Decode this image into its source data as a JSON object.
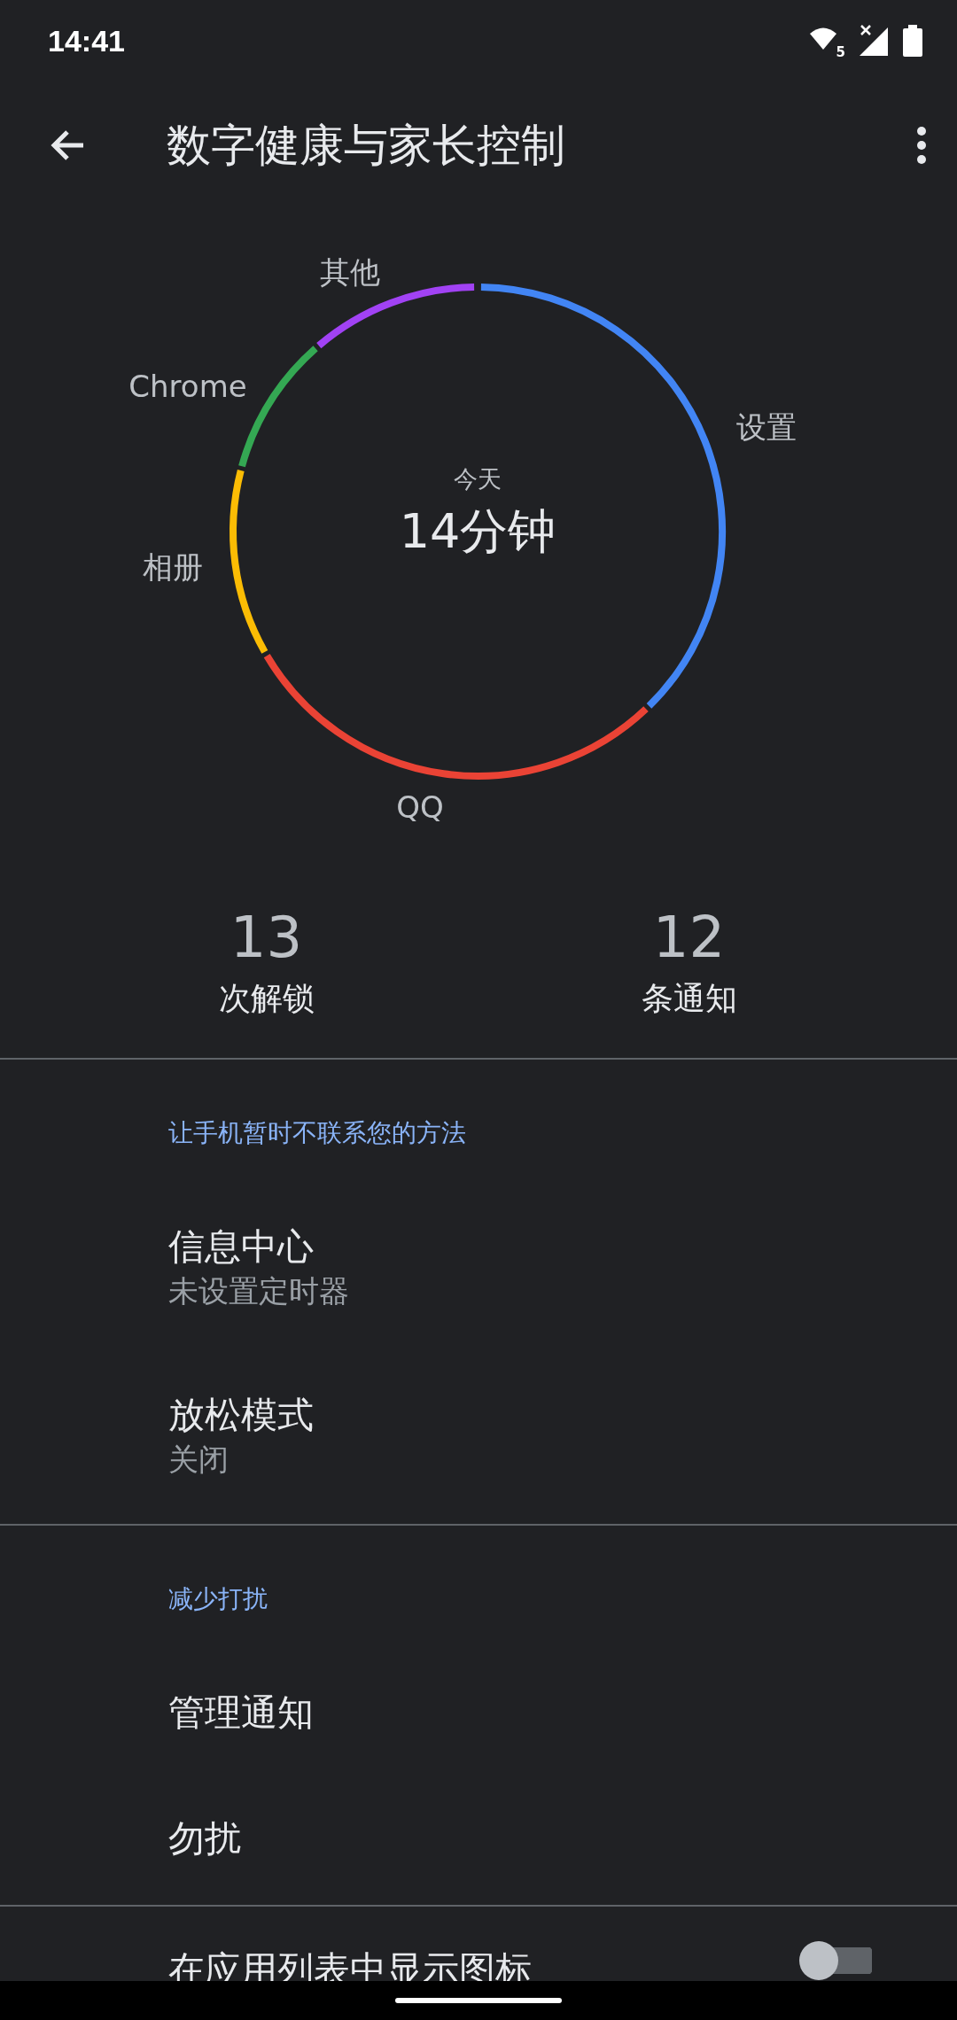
{
  "status_bar": {
    "time": "14:41",
    "wifi_badge": "5"
  },
  "app_bar": {
    "title": "数字健康与家长控制"
  },
  "usage_chart": {
    "labels": [
      {
        "text": "其他"
      },
      {
        "text": "Chrome"
      },
      {
        "text": "设置"
      },
      {
        "text": "相册"
      },
      {
        "text": "QQ"
      }
    ],
    "center_caption": "今天",
    "center_value": "14分钟"
  },
  "stats": [
    {
      "value": "13",
      "label": "次解锁"
    },
    {
      "value": "12",
      "label": "条通知"
    }
  ],
  "sections": [
    {
      "header": "让手机暂时不联系您的方法",
      "items": [
        {
          "kind": "link",
          "title": "信息中心",
          "subtitle": "未设置定时器"
        },
        {
          "kind": "link",
          "title": "放松模式",
          "subtitle": "关闭"
        }
      ]
    },
    {
      "header": "减少打扰",
      "items": [
        {
          "kind": "link",
          "title": "管理通知"
        },
        {
          "kind": "link",
          "title": "勿扰"
        }
      ]
    },
    {
      "items": [
        {
          "kind": "switch",
          "title": "在应用列表中显示图标",
          "checked": false
        }
      ]
    }
  ]
}
